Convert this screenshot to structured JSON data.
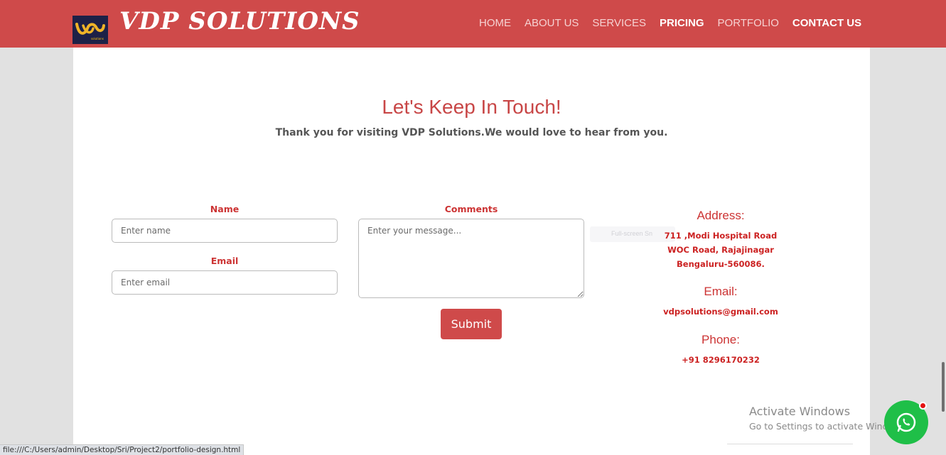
{
  "brand": {
    "name": "VDP SOLUTIONS",
    "logo_subtext": "solutions"
  },
  "nav": [
    {
      "label": "HOME"
    },
    {
      "label": "ABOUT US"
    },
    {
      "label": "SERVICES"
    },
    {
      "label": "PRICING"
    },
    {
      "label": "PORTFOLIO"
    },
    {
      "label": "CONTACT US"
    }
  ],
  "contact": {
    "title": "Let's Keep In Touch!",
    "subtitle": "Thank you for visiting VDP Solutions.We would love to hear from you.",
    "form": {
      "name_label": "Name",
      "name_placeholder": "Enter name",
      "email_label": "Email",
      "email_placeholder": "Enter email",
      "comments_label": "Comments",
      "comments_placeholder": "Enter your message...",
      "submit_label": "Submit"
    },
    "info": {
      "address_heading": "Address:",
      "address_line1": "711 ,Modi Hospital Road",
      "address_line2": "WOC Road, Rajajinagar",
      "address_line3": "Bengaluru-560086.",
      "email_heading": "Email:",
      "email_value": "vdpsolutions@gmail.com",
      "phone_heading": "Phone:",
      "phone_value": "+91 8296170232"
    }
  },
  "overlay_tip": "Full-screen Sn",
  "watermark": {
    "line1": "Activate Windows",
    "line2": "Go to Settings to activate Windows."
  },
  "status_url": "file:///C:/Users/admin/Desktop/Sri/Project2/portfolio-design.html",
  "colors": {
    "brand_red": "#cf4a4a",
    "heading_red": "#c84646",
    "whatsapp_green": "#1fbf48"
  }
}
